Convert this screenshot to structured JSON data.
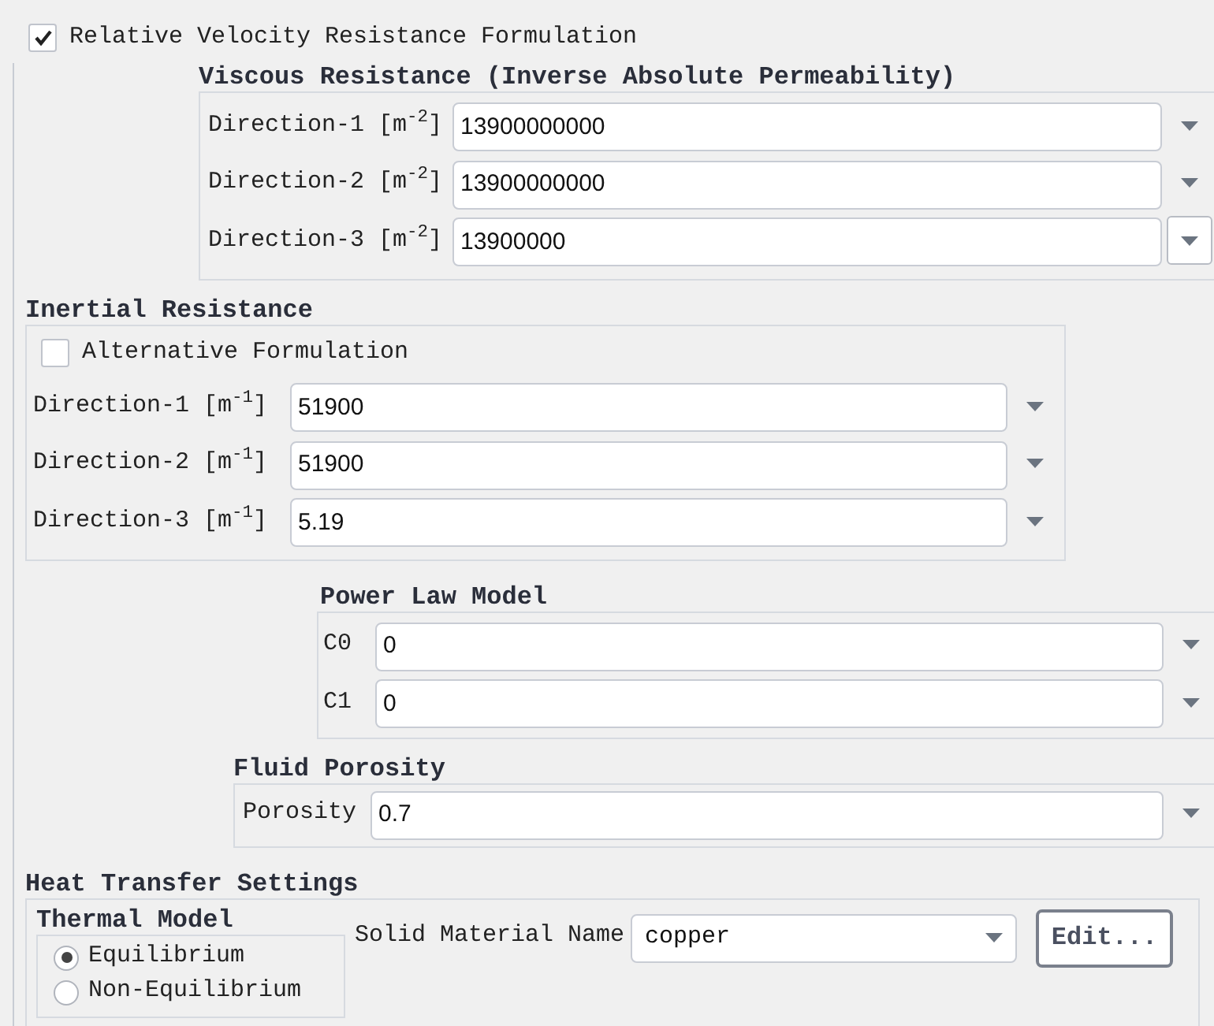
{
  "relative_velocity": {
    "label": "Relative Velocity Resistance Formulation",
    "checked": true
  },
  "viscous_resistance": {
    "title": "Viscous Resistance (Inverse Absolute Permeability)",
    "rows": [
      {
        "label": "Direction-1 [m$^{-2}$]",
        "value": "13900000000",
        "highlighted": false
      },
      {
        "label": "Direction-2 [m$^{-2}$]",
        "value": "13900000000",
        "highlighted": false
      },
      {
        "label": "Direction-3 [m$^{-2}$]",
        "value": "13900000",
        "highlighted": true
      }
    ]
  },
  "inertial_resistance": {
    "title": "Inertial Resistance",
    "alternative": {
      "label": "Alternative Formulation",
      "checked": false
    },
    "rows": [
      {
        "label": "Direction-1 [m$^{-1}$]",
        "value": "51900",
        "highlighted": false
      },
      {
        "label": "Direction-2 [m$^{-1}$]",
        "value": "51900",
        "highlighted": false
      },
      {
        "label": "Direction-3 [m$^{-1}$]",
        "value": "5.19",
        "highlighted": false
      }
    ]
  },
  "power_law_model": {
    "title": "Power Law Model",
    "rows": [
      {
        "label": "C0",
        "value": "0",
        "highlighted": false
      },
      {
        "label": "C1",
        "value": "0",
        "highlighted": false
      }
    ]
  },
  "fluid_porosity": {
    "title": "Fluid Porosity",
    "rows": [
      {
        "label": "Porosity",
        "value": "0.7",
        "highlighted": false
      }
    ]
  },
  "heat_transfer": {
    "title": "Heat Transfer Settings",
    "thermal_model": {
      "title": "Thermal Model",
      "options": [
        {
          "label": "Equilibrium",
          "selected": true
        },
        {
          "label": "Non-Equilibrium",
          "selected": false
        }
      ]
    },
    "solid_material": {
      "label": "Solid Material Name",
      "value": "copper"
    },
    "edit_button": "Edit..."
  }
}
